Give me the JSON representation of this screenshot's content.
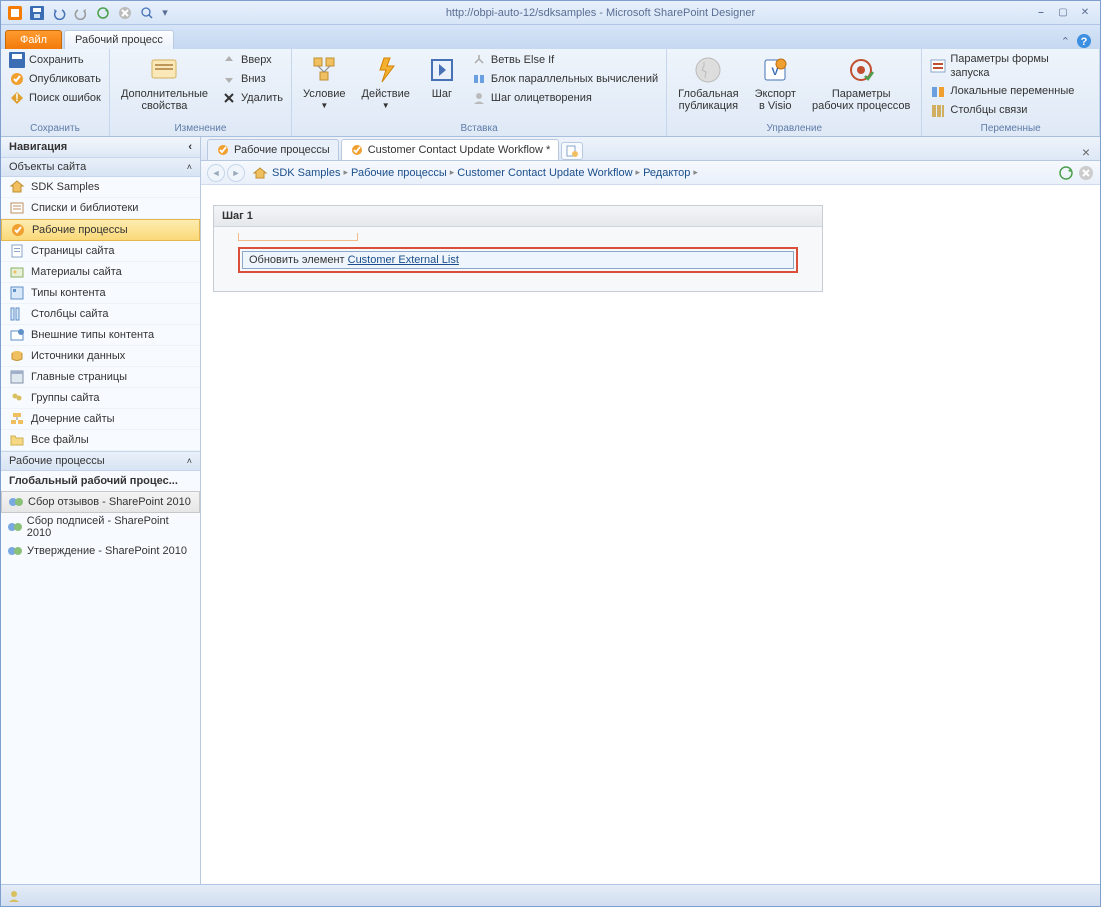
{
  "window": {
    "title": "http://obpi-auto-12/sdksamples - Microsoft SharePoint Designer"
  },
  "tabs": {
    "file": "Файл",
    "workflow": "Рабочий процесс"
  },
  "ribbon": {
    "save": {
      "save": "Сохранить",
      "publish": "Опубликовать",
      "errors": "Поиск ошибок",
      "group": "Сохранить"
    },
    "edit": {
      "props": "Дополнительные\nсвойства",
      "up": "Вверх",
      "down": "Вниз",
      "delete": "Удалить",
      "group": "Изменение"
    },
    "insert": {
      "condition": "Условие",
      "action": "Действие",
      "step": "Шаг",
      "elseif": "Ветвь Else If",
      "parallel": "Блок параллельных вычислений",
      "imperson": "Шаг олицетворения",
      "group": "Вставка"
    },
    "manage": {
      "global": "Глобальная\nпубликация",
      "export": "Экспорт\nв Visio",
      "params": "Параметры\nрабочих процессов",
      "group": "Управление"
    },
    "vars": {
      "form": "Параметры формы запуска",
      "local": "Локальные переменные",
      "assoc": "Столбцы связи",
      "group": "Переменные"
    }
  },
  "nav": {
    "header": "Навигация",
    "objects": "Объекты сайта",
    "items": [
      {
        "label": "SDK Samples",
        "icon": "home"
      },
      {
        "label": "Списки и библиотеки",
        "icon": "list"
      },
      {
        "label": "Рабочие процессы",
        "icon": "wf",
        "selected": true
      },
      {
        "label": "Страницы сайта",
        "icon": "page"
      },
      {
        "label": "Материалы сайта",
        "icon": "assets"
      },
      {
        "label": "Типы контента",
        "icon": "ctype"
      },
      {
        "label": "Столбцы сайта",
        "icon": "col"
      },
      {
        "label": "Внешние типы контента",
        "icon": "ext"
      },
      {
        "label": "Источники данных",
        "icon": "ds"
      },
      {
        "label": "Главные страницы",
        "icon": "master"
      },
      {
        "label": "Группы сайта",
        "icon": "group"
      },
      {
        "label": "Дочерние сайты",
        "icon": "sub"
      },
      {
        "label": "Все файлы",
        "icon": "folder"
      }
    ],
    "wf_section": "Рабочие процессы",
    "wf_global": "Глобальный рабочий процес...",
    "wf_items": [
      {
        "label": "Сбор отзывов - SharePoint 2010",
        "selected": true
      },
      {
        "label": "Сбор подписей - SharePoint 2010"
      },
      {
        "label": "Утверждение - SharePoint 2010"
      }
    ]
  },
  "doctabs": [
    {
      "label": "Рабочие процессы",
      "active": false
    },
    {
      "label": "Customer Contact Update Workflow *",
      "active": true
    }
  ],
  "breadcrumb": [
    "SDK Samples",
    "Рабочие процессы",
    "Customer Contact Update Workflow",
    "Редактор"
  ],
  "step": {
    "title": "Шаг 1",
    "action_prefix": "Обновить элемент ",
    "action_link": "Customer External List"
  }
}
